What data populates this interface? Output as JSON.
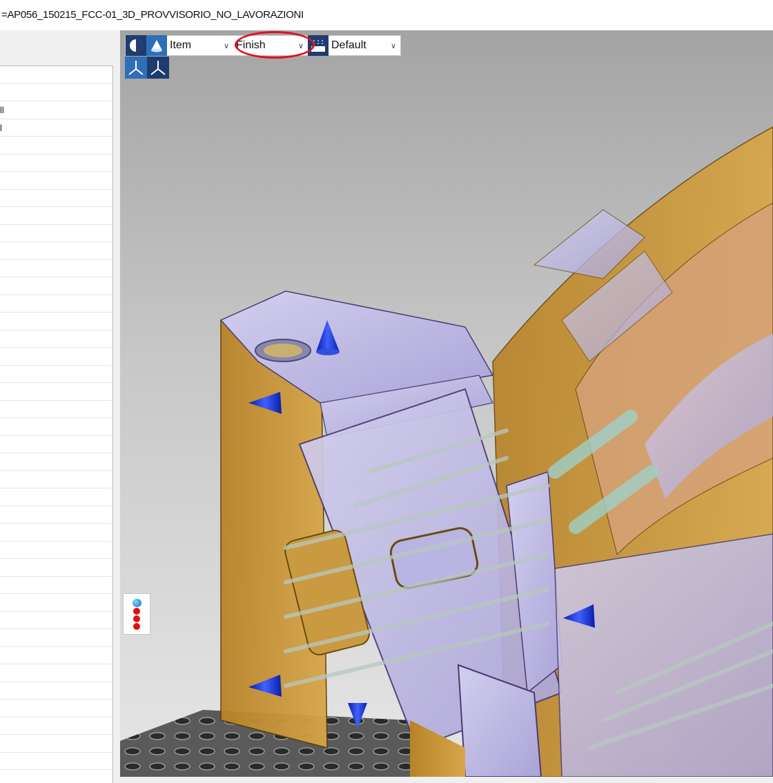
{
  "window": {
    "title": "=AP056_150215_FCC-01_3D_PROVVISORIO_NO_LAVORAZIONI"
  },
  "left_panel": {
    "rows": [
      "",
      "",
      "ll",
      "l",
      "",
      "",
      "",
      "",
      "",
      "",
      "",
      "",
      "",
      "",
      "",
      "",
      "",
      "",
      "",
      "",
      "",
      "",
      "",
      "",
      "",
      "",
      "",
      "",
      "",
      "",
      "",
      "",
      "",
      "",
      "",
      "",
      "",
      "",
      "",
      ""
    ]
  },
  "toolbar": {
    "display_mode_icon": "circle-half-icon",
    "transparency_icon": "cone-icon",
    "item_select": {
      "value": "Item"
    },
    "finish_select": {
      "value": "Finish",
      "highlighted": true,
      "highlight_color": "#e01020"
    },
    "render_icon": "render-style-icon",
    "default_select": {
      "value": "Default"
    }
  },
  "axis_icons": [
    "axis-tripod-icon",
    "axis-tripod-icon"
  ],
  "viewport": {
    "background_top": "#a8a8a8",
    "background_bottom": "#e8e8e8",
    "model_color": "#c8902a",
    "model_transparent_color": "#b6b2e0"
  },
  "side_widget": {
    "icon": "point-stack-icon"
  }
}
